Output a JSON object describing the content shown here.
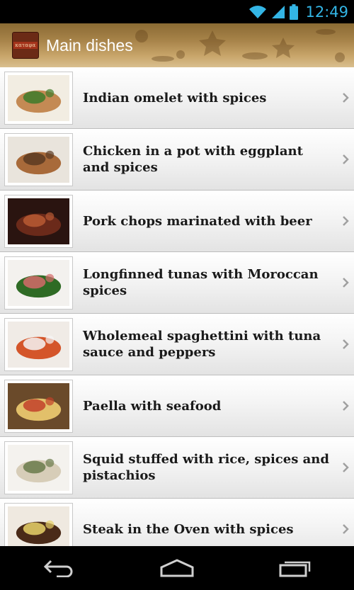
{
  "status_bar": {
    "time": "12:49",
    "icons": [
      "wifi-icon",
      "signal-icon",
      "battery-icon"
    ],
    "accent": "#33b5e5"
  },
  "action_bar": {
    "title": "Main dishes",
    "logo_text": "καταφα",
    "icons": [
      "app-logo"
    ]
  },
  "recipes": [
    {
      "title": "Indian omelet with spices",
      "thumb_colors": [
        "#f2ede2",
        "#c48a54",
        "#3e7a2a"
      ]
    },
    {
      "title": "Chicken in a pot with eggplant and spices",
      "thumb_colors": [
        "#e9e4dc",
        "#a86a3a",
        "#5b3a22"
      ]
    },
    {
      "title": "Pork chops marinated with beer",
      "thumb_colors": [
        "#2a1410",
        "#6b2a1a",
        "#b85a34"
      ]
    },
    {
      "title": "Longfinned tunas with Moroccan spices",
      "thumb_colors": [
        "#f3f1ee",
        "#2f6b25",
        "#d46a6a"
      ]
    },
    {
      "title": "Wholemeal spaghettini with tuna sauce and peppers",
      "thumb_colors": [
        "#f0ebe6",
        "#d4552a",
        "#f5f5f5"
      ]
    },
    {
      "title": "Paella with seafood",
      "thumb_colors": [
        "#6a4a2a",
        "#e2c06a",
        "#c2412a"
      ]
    },
    {
      "title": "Squid stuffed with rice, spices and pistachios",
      "thumb_colors": [
        "#f4f2ee",
        "#d7cdb8",
        "#6a7a4a"
      ]
    },
    {
      "title": "Steak in the Oven with spices",
      "thumb_colors": [
        "#efe9e0",
        "#4a2a18",
        "#e8d26a"
      ]
    }
  ],
  "nav_bar": {
    "icons": [
      "back-icon",
      "home-icon",
      "recent-apps-icon"
    ]
  }
}
